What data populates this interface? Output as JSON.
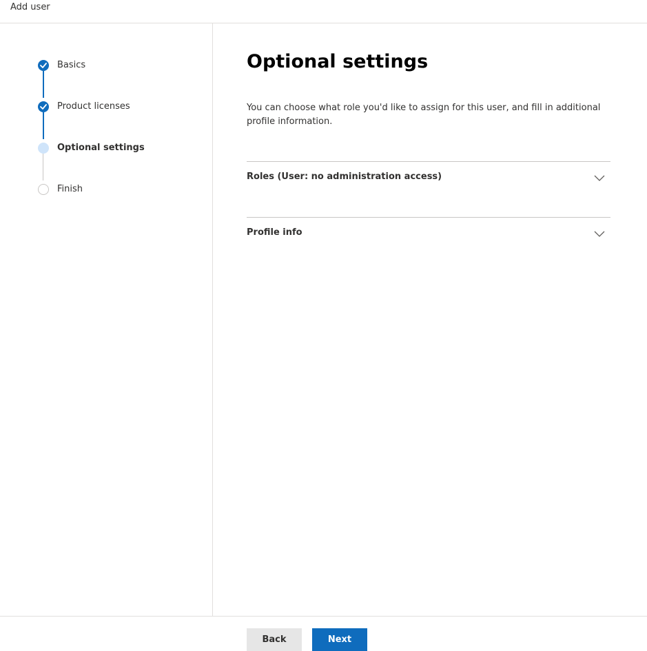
{
  "header": {
    "title": "Add user"
  },
  "wizard": {
    "steps": [
      {
        "label": "Basics",
        "status": "done",
        "icon": "checkmark-icon"
      },
      {
        "label": "Product licenses",
        "status": "done",
        "icon": "checkmark-icon"
      },
      {
        "label": "Optional settings",
        "status": "current",
        "icon": "current-step-dot-icon"
      },
      {
        "label": "Finish",
        "status": "pending",
        "icon": "pending-step-circle-icon"
      }
    ]
  },
  "main": {
    "title": "Optional settings",
    "description": "You can choose what role you'd like to assign for this user, and fill in additional profile information.",
    "sections": [
      {
        "label": "Roles (User: no administration access)",
        "icon": "chevron-down-icon"
      },
      {
        "label": "Profile info",
        "icon": "chevron-down-icon"
      }
    ]
  },
  "footer": {
    "back_label": "Back",
    "next_label": "Next"
  },
  "colors": {
    "accent": "#0f6cbd",
    "current_step": "#cfe4fa",
    "border": "#e1dfdd"
  }
}
